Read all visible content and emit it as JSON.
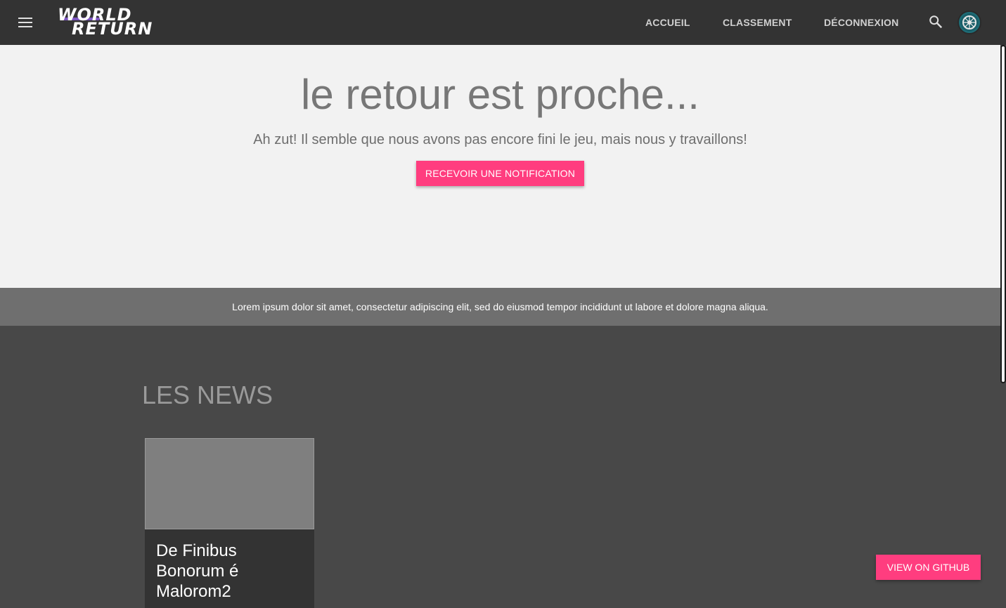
{
  "header": {
    "logo_line1": "WORLD",
    "logo_line2": "RETURN",
    "nav": [
      {
        "label": "ACCUEIL"
      },
      {
        "label": "CLASSEMENT"
      },
      {
        "label": "DÉCONNEXION"
      }
    ],
    "icons": [
      "menu-icon",
      "search-icon",
      "avatar-icon"
    ]
  },
  "hero": {
    "title": "le retour est proche...",
    "subtitle": "Ah zut! Il semble que nous avons pas encore fini le jeu, mais nous y travaillons!",
    "button_label": "RECEVOIR UNE NOTIFICATION"
  },
  "banner": {
    "text": "Lorem ipsum dolor sit amet, consectetur adipiscing elit, sed do eiusmod tempor incididunt ut labore et dolore magna aliqua."
  },
  "news": {
    "title": "LES NEWS",
    "cards": [
      {
        "title": "De Finibus Bonorum é Malorom2"
      }
    ]
  },
  "github_button": "VIEW ON GITHUB",
  "colors": {
    "accent": "#ff3d7f",
    "topbar": "#333333",
    "hero_bg": "#f2f2f2",
    "page_bg": "#484848"
  }
}
